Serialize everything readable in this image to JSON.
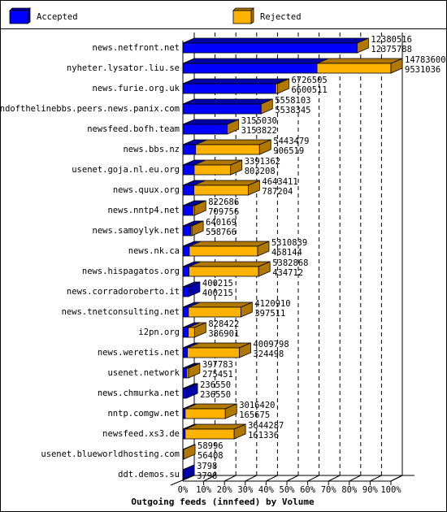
{
  "chart_data": {
    "type": "bar",
    "orientation": "horizontal",
    "stacked": true,
    "three_d": true,
    "title": "Outgoing feeds (innfeed) by Volume",
    "xlabel": "",
    "ylabel": "",
    "x_unit": "percent of max total",
    "xlim_percent": [
      0,
      100
    ],
    "x_ticks": [
      "0%",
      "10%",
      "20%",
      "30%",
      "40%",
      "50%",
      "60%",
      "70%",
      "80%",
      "90%",
      "100%"
    ],
    "grid": true,
    "legend": {
      "placement": "top",
      "entries": [
        {
          "name": "Accepted",
          "color": "#0000FF",
          "side_color": "#0000A8"
        },
        {
          "name": "Rejected",
          "color": "#FFB300",
          "side_color": "#B07800"
        }
      ]
    },
    "categories": [
      "news.netfront.net",
      "nyheter.lysator.liu.se",
      "news.furie.org.uk",
      "endofthelinebbs.peers.news.panix.com",
      "newsfeed.bofh.team",
      "news.bbs.nz",
      "usenet.goja.nl.eu.org",
      "news.quux.org",
      "news.nntp4.net",
      "news.samoylyk.net",
      "news.nk.ca",
      "news.hispagatos.org",
      "news.corradoroberto.it",
      "news.tnetconsulting.net",
      "i2pn.org",
      "news.weretis.net",
      "usenet.network",
      "news.chmurka.net",
      "nntp.comgw.net",
      "newsfeed.xs3.de",
      "usenet.blueworldhosting.com",
      "ddt.demos.su"
    ],
    "totals": [
      12380516,
      14783600,
      6726505,
      5558103,
      3155030,
      5443479,
      3391362,
      4643411,
      822686,
      640169,
      5310839,
      5382868,
      400215,
      4120910,
      828422,
      4009798,
      397783,
      236550,
      3016420,
      3644287,
      58996,
      3798
    ],
    "series": [
      {
        "name": "Accepted",
        "values": [
          12375788,
          9531036,
          6600511,
          5538345,
          3153822,
          906519,
          803208,
          787204,
          709756,
          558766,
          458144,
          434712,
          400215,
          397511,
          386901,
          324498,
          275451,
          236550,
          165675,
          161336,
          56408,
          3798
        ]
      },
      {
        "name": "Rejected",
        "values": [
          4728,
          5252564,
          125994,
          19758,
          1208,
          4536960,
          2588154,
          3856207,
          112930,
          81403,
          4852695,
          4948156,
          0,
          3723399,
          441521,
          3685300,
          122332,
          0,
          2850745,
          3482951,
          2588,
          0
        ]
      }
    ]
  }
}
